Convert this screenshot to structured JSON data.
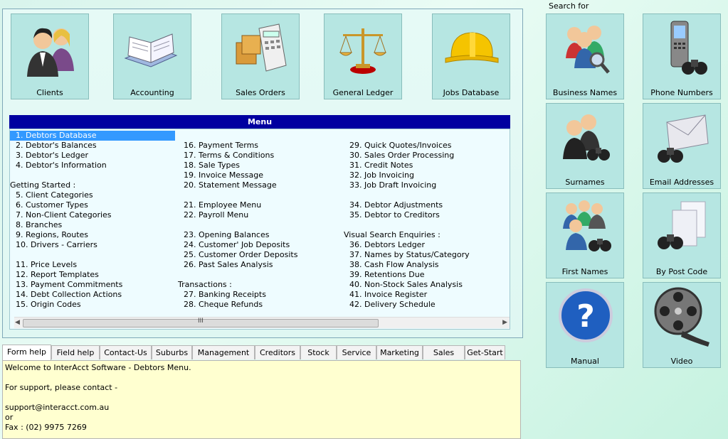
{
  "top_tiles": [
    {
      "label": "Clients",
      "icon": "people-icon"
    },
    {
      "label": "Accounting",
      "icon": "book-icon"
    },
    {
      "label": "Sales Orders",
      "icon": "calculator-boxes-icon"
    },
    {
      "label": "General Ledger",
      "icon": "scales-icon"
    },
    {
      "label": "Jobs Database",
      "icon": "hardhat-icon"
    }
  ],
  "menu": {
    "title": "Menu",
    "col1": [
      "1. Debtors Database",
      "2. Debtor's Balances",
      "3. Debtor's Ledger",
      "4. Debtor's Information",
      "",
      "Getting Started :",
      "5. Client Categories",
      "6. Customer Types",
      "7. Non-Client Categories",
      "8. Branches",
      "9. Regions, Routes",
      "10. Drivers - Carriers",
      "",
      "11. Price Levels",
      "12. Report Templates",
      "13. Payment Commitments",
      "14. Debt Collection Actions",
      "15. Origin Codes"
    ],
    "col2": [
      "",
      "16. Payment Terms",
      "17. Terms & Conditions",
      "18. Sale Types",
      "19. Invoice Message",
      "20. Statement Message",
      "",
      "21. Employee Menu",
      "22. Payroll Menu",
      "",
      "23. Opening Balances",
      "24. Customer' Job Deposits",
      "25. Customer Order Deposits",
      "26. Past Sales Analysis",
      "",
      "Transactions :",
      "27. Banking Receipts",
      "28. Cheque Refunds"
    ],
    "col3": [
      "",
      "29. Quick Quotes/Invoices",
      "30. Sales Order Processing",
      "31. Credit Notes",
      "32. Job Invoicing",
      "33. Job Draft Invoicing",
      "",
      "34. Debtor Adjustments",
      "35. Debtor to Creditors",
      "",
      "Visual Search Enquiries :",
      "36. Debtors Ledger",
      "37. Names by Status/Category",
      "38. Cash Flow Analysis",
      "39. Retentions Due",
      "40. Non-Stock Sales Analysis",
      "41. Invoice Register",
      "42. Delivery Schedule"
    ]
  },
  "scrollbar": {
    "grip": "III",
    "left": "◀",
    "right": "▶"
  },
  "tabs": [
    "Form help",
    "Field help",
    "Contact-Us",
    "Suburbs",
    "Management",
    "Creditors",
    "Stock",
    "Service",
    "Marketing",
    "Sales",
    "Get-Start"
  ],
  "help": {
    "line1": "Welcome to InterAcct Software - Debtors Menu.",
    "line2": "For support, please contact -",
    "line3": "support@interacct.com.au",
    "line4": "or",
    "line5": "Fax : (02) 9975 7269"
  },
  "search": {
    "heading": "Search for",
    "tiles": [
      {
        "label": "Business Names",
        "icon": "people-magnifier-icon"
      },
      {
        "label": "Phone Numbers",
        "icon": "phone-binoculars-icon"
      },
      {
        "label": "Surnames",
        "icon": "people-binoculars-icon"
      },
      {
        "label": "Email Addresses",
        "icon": "envelope-binoculars-icon"
      },
      {
        "label": "First Names",
        "icon": "group-binoculars-icon"
      },
      {
        "label": "By Post Code",
        "icon": "cards-binoculars-icon"
      },
      {
        "label": "Manual",
        "icon": "question-icon"
      },
      {
        "label": "Video",
        "icon": "film-reel-icon"
      }
    ]
  },
  "colors": {
    "menu_header": "#0000a0",
    "tile_bg": "#b6e6e2",
    "selected": "#3399ff",
    "help_bg": "#ffffd0"
  }
}
